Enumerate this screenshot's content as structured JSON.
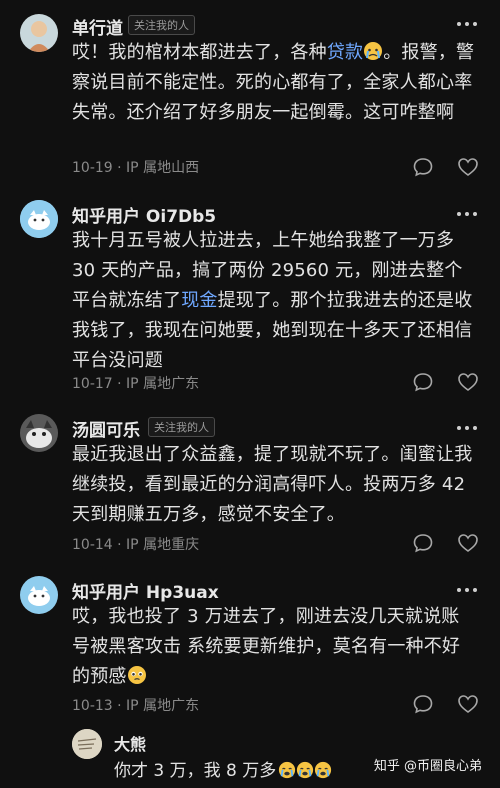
{
  "comments": [
    {
      "user": "单行道",
      "badge": "关注我的人",
      "text_parts": [
        "哎！我的棺材本都进去了，各种",
        "贷款",
        "。报警，警察说目前不能定性。死的心都有了，全家人都心率失常。还介绍了好多朋友一起倒霉。这可咋整啊"
      ],
      "date": "10-19",
      "location": "IP 属地山西"
    },
    {
      "user": "知乎用户 Oi7Db5",
      "text_parts": [
        "我十月五号被人拉进去，上午她给我整了一万多 30 天的产品，搞了两份 29560 元，刚进去整个平台就冻结了",
        "现金",
        "提现了。那个拉我进去的还是收我钱了，我现在问她要，她到现在十多天了还相信平台没问题"
      ],
      "date": "10-17",
      "location": "IP 属地广东"
    },
    {
      "user": "汤圆可乐",
      "badge": "关注我的人",
      "text": "最近我退出了众益鑫，提了现就不玩了。闺蜜让我继续投，看到最近的分润高得吓人。投两万多 42 天到期赚五万多，感觉不安全了。",
      "date": "10-14",
      "location": "IP 属地重庆"
    },
    {
      "user": "知乎用户 Hp3uax",
      "text": "哎，我也投了 3 万进去了，刚进去没几天就说账号被黑客攻击 系统要更新维护，莫名有一种不好的预感",
      "date": "10-13",
      "location": "IP 属地广东"
    }
  ],
  "reply": {
    "user": "大熊",
    "text": "你才 3 万，我 8 万多"
  },
  "separator": "·",
  "watermark": "知乎 @币圈良心弟",
  "colors": {
    "background": "#101010",
    "link": "#6fa8ff",
    "meta": "#8a8a8a"
  }
}
